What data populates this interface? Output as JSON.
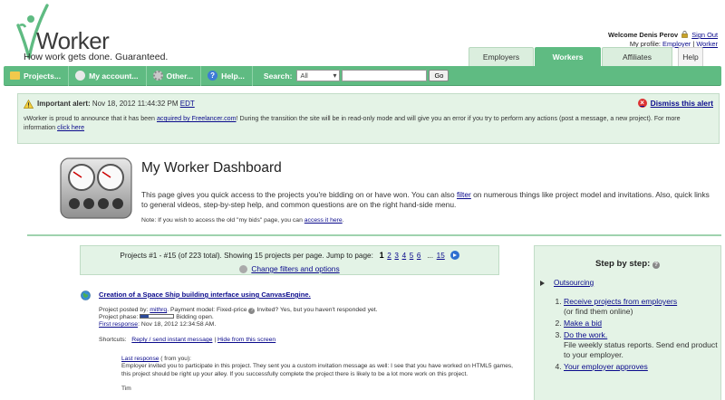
{
  "header": {
    "logo_text": "Worker",
    "tagline": "How work gets done. Guaranteed.",
    "welcome": "Welcome Denis Perov",
    "sign_out": "Sign Out",
    "profile_label": "My profile:",
    "profile_employer": "Employer",
    "profile_sep": "|",
    "profile_worker": "Worker"
  },
  "tabs": [
    {
      "label": "Employers",
      "active": false
    },
    {
      "label": "Workers",
      "active": true
    },
    {
      "label": "Affiliates",
      "active": false
    }
  ],
  "help_tab": "Help",
  "menu": {
    "items": [
      {
        "label": "Projects...",
        "icon": "folder-icon"
      },
      {
        "label": "My account...",
        "icon": "person-icon"
      },
      {
        "label": "Other...",
        "icon": "gear-icon"
      },
      {
        "label": "Help...",
        "icon": "help-icon"
      }
    ],
    "search_label": "Search:",
    "search_select": "All",
    "search_value": "",
    "go_label": "Go"
  },
  "alert": {
    "title": "Important alert:",
    "date": "Nov 18, 2012 11:44:32 PM",
    "tz": "EDT",
    "dismiss": "Dismiss this alert",
    "body_1": "vWorker is proud to announce that it has been",
    "body_link": "acquired by Freelancer.com",
    "body_2": "! During the transition the site will be in read-only mode and will give you an error if you try to perform any actions (post a message, a new project). For more information",
    "click_here": "click here"
  },
  "dashboard": {
    "title": "My Worker Dashboard",
    "intro_1": "This page gives you quick access to the projects you're bidding on or have won. You can also",
    "filter_link": "filter",
    "intro_2": "on numerous things like project model and invitations. Also, quick links to general videos, step-by-step help, and common questions are on the right hand-side menu.",
    "note_1": "Note: If you wish to access the old \"my bids\" page, you can",
    "note_link": "access it here",
    "note_2": "."
  },
  "pager": {
    "summary": "Projects #1 - #15 (of 223 total). Showing 15 projects per page. Jump to page:",
    "current_page": "1",
    "pages": [
      "2",
      "3",
      "4",
      "5",
      "6"
    ],
    "ellipsis": "...",
    "last_page": "15",
    "change_filters": "Change filters and options"
  },
  "project": {
    "title": "Creation of a Space Ship building interface using CanvasEngine.",
    "posted_by_label": "Project posted by:",
    "posted_by": "mithrq",
    "payment_model": ". Payment model: Fixed-price",
    "invited": "Invited? Yes, but you haven't responded yet.",
    "phase_label": "Project phase:",
    "phase_progress": 0.25,
    "phase_text": "Bidding open.",
    "first_response_label": "First response",
    "first_response": ": Nov 18, 2012 12:34:58 AM.",
    "shortcuts_label": "Shortcuts:",
    "shortcut_reply": "Reply / send instant message",
    "shortcut_sep": "|",
    "shortcut_hide": "Hide from this screen",
    "last_response_label": "Last response",
    "last_response_from": "( from you):",
    "last_response_text": "Employer invited you to participate in this project. They sent you a custom invitation message as well: I see that you have worked on HTML5 games, this project should be right up your alley. If you successfully complete the project there is likely to be a lot more work on this project.",
    "signature": "Tim"
  },
  "steps": {
    "title": "Step by step:",
    "outsourcing": "Outsourcing",
    "items": [
      {
        "link": "Receive projects from employers",
        "text": "(or find them online)"
      },
      {
        "link": "Make a bid",
        "text": ""
      },
      {
        "link": "Do the work.",
        "text": "File weekly status reports. Send end product to your employer."
      },
      {
        "link": "Your employer approves",
        "text": ""
      }
    ]
  },
  "colors": {
    "brand_green": "#5fbb82",
    "alert_bg": "#e4f3e6",
    "link": "#0a0a8c"
  }
}
